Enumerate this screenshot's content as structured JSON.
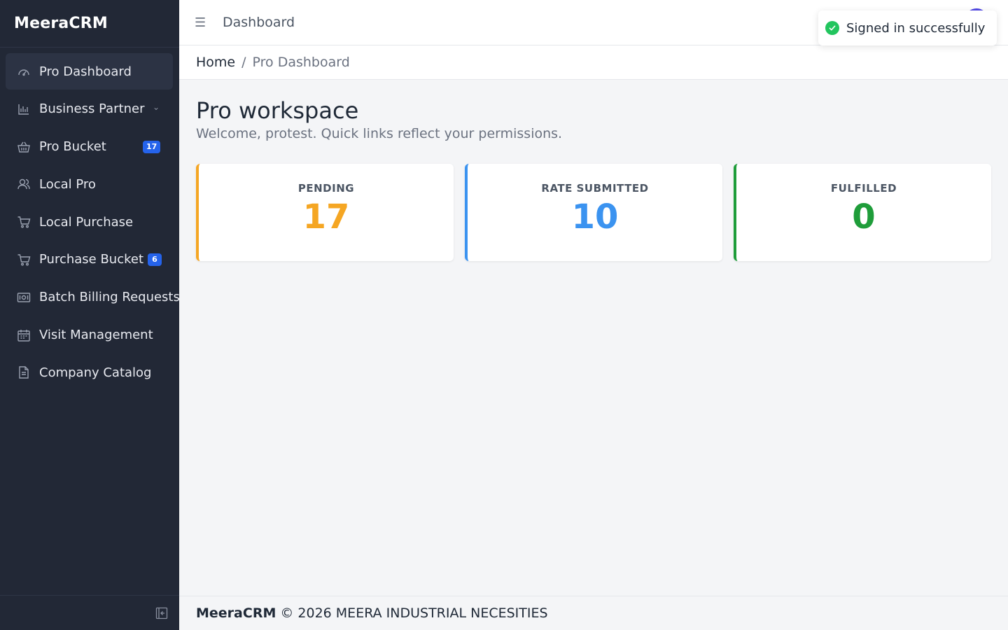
{
  "app": {
    "brand": "MeeraCRM"
  },
  "sidebar": {
    "items": [
      {
        "label": "Pro Dashboard",
        "icon": "gauge-icon",
        "active": true
      },
      {
        "label": "Business Partner",
        "icon": "chart-icon",
        "has_submenu": true
      },
      {
        "label": "Pro Bucket",
        "icon": "basket-icon",
        "badge": "17"
      },
      {
        "label": "Local Pro",
        "icon": "users-icon"
      },
      {
        "label": "Local Purchase",
        "icon": "cart-icon"
      },
      {
        "label": "Purchase Bucket",
        "icon": "cart-icon",
        "badge": "6"
      },
      {
        "label": "Batch Billing Requests",
        "icon": "bill-icon"
      },
      {
        "label": "Visit Management",
        "icon": "calendar-icon"
      },
      {
        "label": "Company Catalog",
        "icon": "document-icon"
      }
    ]
  },
  "topbar": {
    "title": "Dashboard"
  },
  "breadcrumb": {
    "home": "Home",
    "separator": "/",
    "current": "Pro Dashboard"
  },
  "main": {
    "title": "Pro workspace",
    "subtitle": "Welcome, protest. Quick links reflect your permissions.",
    "cards": [
      {
        "label": "PENDING",
        "value": "17",
        "color": "#f5a623"
      },
      {
        "label": "RATE SUBMITTED",
        "value": "10",
        "color": "#3b93f0"
      },
      {
        "label": "FULFILLED",
        "value": "0",
        "color": "#1f9d3a"
      }
    ]
  },
  "footer": {
    "brand": "MeeraCRM",
    "text": "© 2026 MEERA INDUSTRIAL NECESITIES"
  },
  "toast": {
    "message": "Signed in successfully",
    "icon": "check-circle-icon"
  },
  "colors": {
    "sidebar_bg": "#222836",
    "accent": "#2563eb",
    "avatar": "#4f46e5"
  }
}
